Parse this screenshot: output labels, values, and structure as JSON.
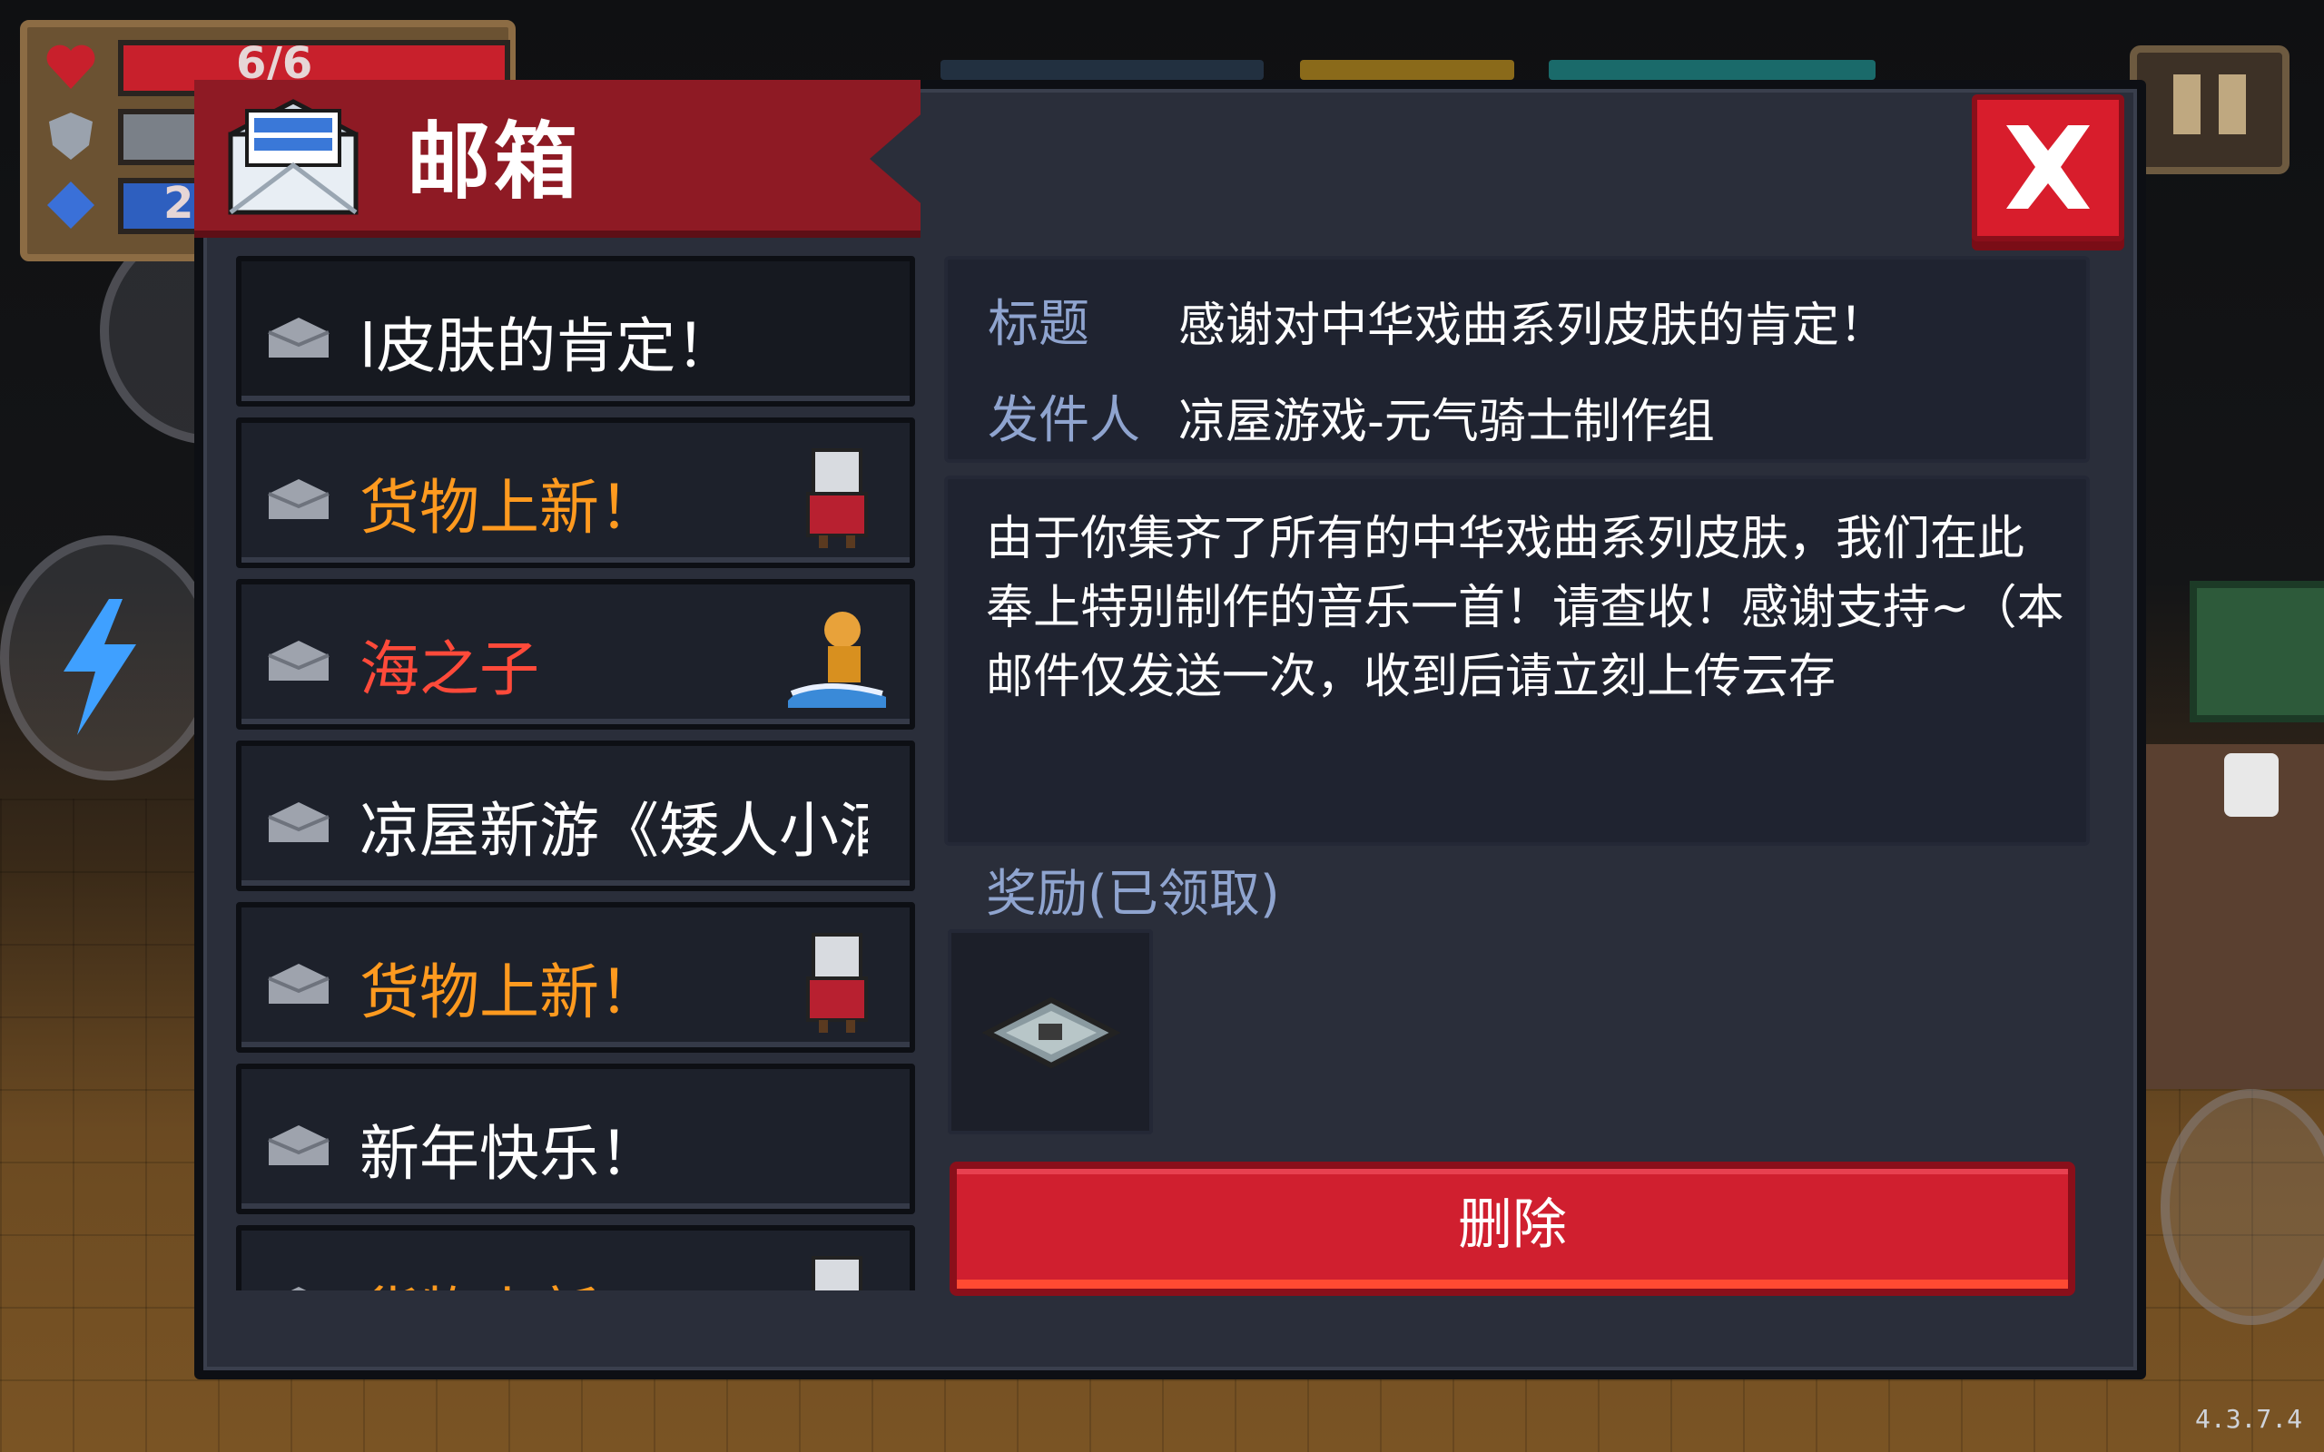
{
  "hud": {
    "health_text": "6/6",
    "energy_text": "2"
  },
  "mailbox": {
    "title": "邮箱",
    "close_icon": "close-x-icon",
    "list": [
      {
        "label": "l皮肤的肯定！",
        "color": "#ffffff",
        "thumb": "none"
      },
      {
        "label": "货物上新！",
        "color": "#ff9a1f",
        "thumb": "merchant-cat"
      },
      {
        "label": "海之子",
        "color": "#ff4a3a",
        "thumb": "surfer"
      },
      {
        "label": "凉屋新游《矮人小酒馆》",
        "color": "#ffffff",
        "thumb": "none"
      },
      {
        "label": "货物上新！",
        "color": "#ff9a1f",
        "thumb": "merchant-cat"
      },
      {
        "label": "新年快乐！",
        "color": "#ffffff",
        "thumb": "none"
      },
      {
        "label": "货物上新！",
        "color": "#ff9a1f",
        "thumb": "merchant-cat"
      }
    ],
    "detail": {
      "subject_label": "标题",
      "subject_value": "感谢对中华戏曲系列皮肤的肯定！",
      "sender_label": "发件人",
      "sender_value": "凉屋游戏-元气骑士制作组",
      "body": "由于你集齐了所有的中华戏曲系列皮肤，我们在此奉上特别制作的音乐一首！请查收！感谢支持~（本邮件仅发送一次，收到后请立刻上传云存",
      "reward_label": "奖励(已领取)",
      "reward_icon": "music-record-icon",
      "delete_label": "删除"
    }
  },
  "version": "4.3.7.4"
}
